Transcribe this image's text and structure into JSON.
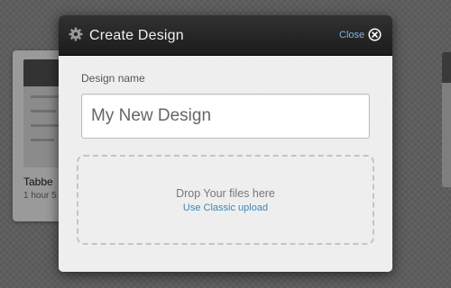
{
  "background": {
    "card": {
      "title": "Tabbe",
      "meta": "1 hour 5"
    }
  },
  "modal": {
    "title": "Create Design",
    "close_label": "Close",
    "header_icon": "gear-icon",
    "close_icon": "close-circle-icon",
    "form": {
      "name_label": "Design name",
      "name_value": "My New Design"
    },
    "drop_zone": {
      "text": "Drop Your files here",
      "link": "Use Classic upload"
    }
  },
  "colors": {
    "header_bg": "#262626",
    "link": "#3d86b8",
    "close_link": "#7fb2e0",
    "body_bg": "#efefef"
  }
}
